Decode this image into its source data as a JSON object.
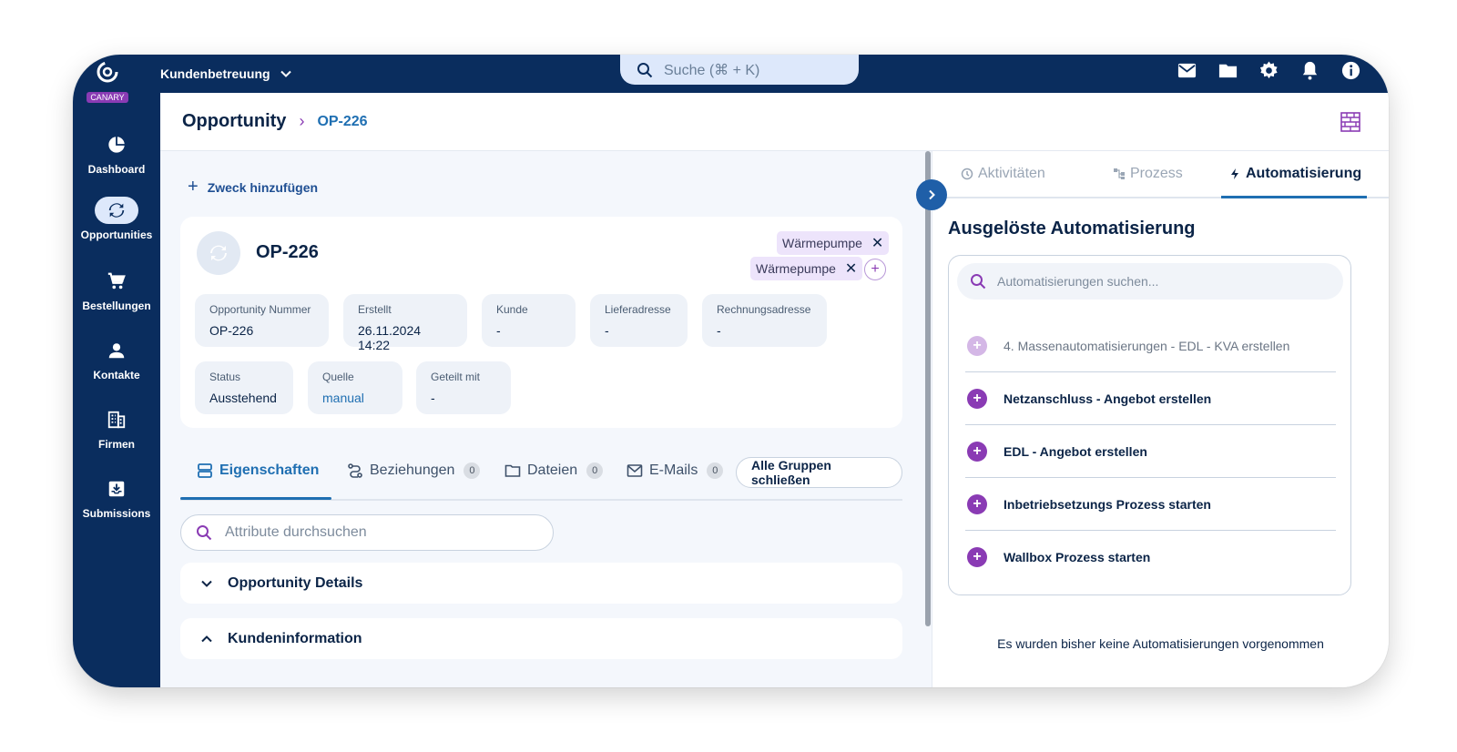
{
  "brand": {
    "badge": "CANARY",
    "accent": "#8a3bb4",
    "navy": "#0a2d5e",
    "link": "#1f6fb2"
  },
  "topbar": {
    "app_switch": "Kundenbetreuung",
    "search_placeholder": "Suche (⌘ + K)",
    "icons": [
      "mail-icon",
      "folder-icon",
      "gear-icon",
      "bell-icon",
      "info-icon"
    ]
  },
  "sidebar": {
    "items": [
      {
        "label": "Dashboard",
        "icon": "pie-chart-icon"
      },
      {
        "label": "Opportunities",
        "icon": "sync-icon",
        "active": true
      },
      {
        "label": "Bestellungen",
        "icon": "cart-icon"
      },
      {
        "label": "Kontakte",
        "icon": "person-icon"
      },
      {
        "label": "Firmen",
        "icon": "building-icon"
      },
      {
        "label": "Submissions",
        "icon": "inbox-icon"
      }
    ]
  },
  "header": {
    "root": "Opportunity",
    "separator": "›",
    "current": "OP-226"
  },
  "content": {
    "add_purpose": "Zweck hinzufügen",
    "title": "OP-226",
    "tags": [
      "Wärmepumpe",
      "Wärmepumpe"
    ],
    "fields": [
      {
        "label": "Opportunity Nummer",
        "value": "OP-226"
      },
      {
        "label": "Erstellt",
        "value": "26.11.2024 14:22"
      },
      {
        "label": "Kunde",
        "value": "-"
      },
      {
        "label": "Lieferadresse",
        "value": "-"
      },
      {
        "label": "Rechnungsadresse",
        "value": "-"
      },
      {
        "label": "Status",
        "value": "Ausstehend"
      },
      {
        "label": "Quelle",
        "value": "manual"
      },
      {
        "label": "Geteilt mit",
        "value": "-"
      }
    ],
    "tabs": [
      {
        "label": "Eigenschaften",
        "active": true
      },
      {
        "label": "Beziehungen",
        "count": "0"
      },
      {
        "label": "Dateien",
        "count": "0"
      },
      {
        "label": "E-Mails",
        "count": "0"
      }
    ],
    "group_button": "Alle Gruppen schließen",
    "attr_search_placeholder": "Attribute durchsuchen",
    "sections": [
      "Opportunity Details",
      "Kundeninformation"
    ]
  },
  "panel": {
    "tabs": [
      {
        "label": "Aktivitäten"
      },
      {
        "label": "Prozess"
      },
      {
        "label": "Automatisierung",
        "active": true
      }
    ],
    "title": "Ausgelöste Automatisierung",
    "search_placeholder": "Automatisierungen suchen...",
    "items": [
      "4. Massenautomatisierungen - EDL - KVA erstellen",
      "Netzanschluss - Angebot erstellen",
      "EDL - Angebot erstellen",
      "Inbetriebsetzungs Prozess starten",
      "Wallbox Prozess starten"
    ],
    "empty_note": "Es wurden bisher keine Automatisierungen vorgenommen"
  }
}
